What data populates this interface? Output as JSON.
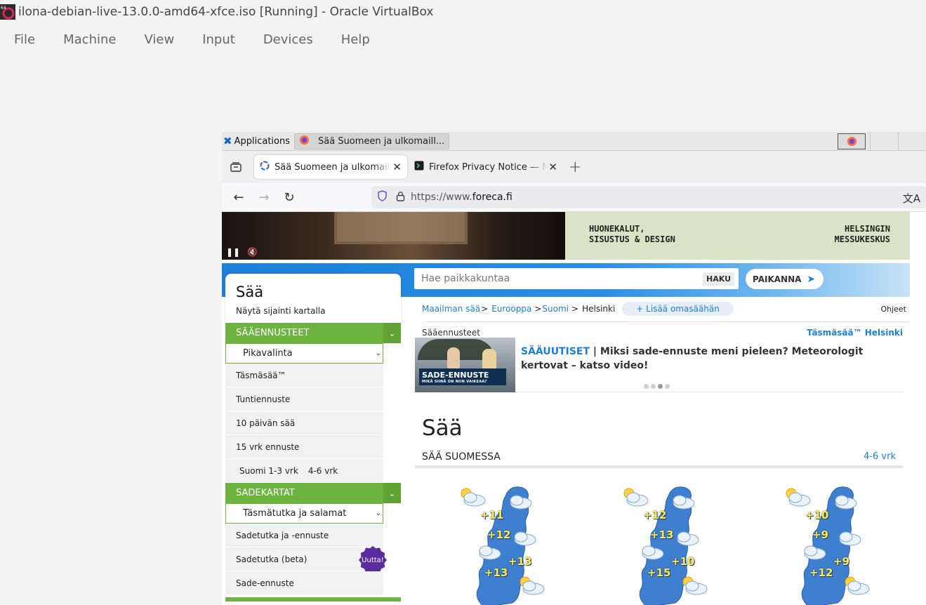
{
  "host": {
    "title": "ilona-debian-live-13.0.0-amd64-xfce.iso [Running] - Oracle VirtualBox",
    "menu": [
      "File",
      "Machine",
      "View",
      "Input",
      "Devices",
      "Help"
    ]
  },
  "xfce": {
    "applications_label": "Applications",
    "task_label": "Sää Suomeen ja ulkomaill..."
  },
  "browser": {
    "tabs": [
      {
        "label": "Sää Suomeen ja ulkomaille",
        "active": true
      },
      {
        "label": "Firefox Privacy Notice — M",
        "active": false
      }
    ],
    "url_prefix": "https://www.",
    "url_domain": "foreca.fi"
  },
  "ad": {
    "left_line1": "HUONEKALUT,",
    "left_line2": "SISUSTUS & DESIGN",
    "right_line1": "HELSINGIN",
    "right_line2": "MESSUKESKUS"
  },
  "search": {
    "placeholder": "Hae paikkakuntaa",
    "button": "HAKU",
    "locate": "PAIKANNA"
  },
  "sidebar": {
    "title": "Sää",
    "map_link": "Näytä sijainti kartalla",
    "section1": "SÄÄENNUSTEET",
    "select1": "Pikavalinta",
    "items1": [
      "Täsmäsää™",
      "Tuntiennuste",
      "10 päivän sää",
      "15 vrk ennuste"
    ],
    "suomi_label": "Suomi 1-3 vrk",
    "suomi_label2": "4-6 vrk",
    "section2": "SADEKARTAT",
    "select2": "Täsmätutka ja salamat",
    "items2": [
      "Sadetutka ja -ennuste",
      "Sadetutka (beta)",
      "Sade-ennuste"
    ],
    "badge": "Uutta!"
  },
  "breadcrumb": {
    "l1": "Maailman sää",
    "l2": "Eurooppa",
    "l3": "Suomi",
    "current": "Helsinki",
    "add_fav": "+ Lisää omasäähän",
    "help": "Ohjeet"
  },
  "forecast_head": {
    "left": "Sääennusteet",
    "right": "Täsmäsää™ Helsinki"
  },
  "news": {
    "tag": "SÄÄUUTISET",
    "sep": " | ",
    "headline": "Miksi sade-ennuste meni pieleen? Meteorologit kertovat – katso video!",
    "thumb_title": "SADE-ENNUSTE",
    "thumb_sub": "MIKÄ SIINÄ ON NIIN VAIKEAA?"
  },
  "main": {
    "heading": "Sää",
    "section": "SÄÄ SUOMESSA",
    "section_link": "4-6 vrk"
  },
  "maps": [
    {
      "temps": [
        "+11",
        "+12",
        "+13",
        "+13"
      ]
    },
    {
      "temps": [
        "+12",
        "+13",
        "+10",
        "+15"
      ]
    },
    {
      "temps": [
        "+10",
        "+9",
        "+9",
        "+12"
      ]
    }
  ],
  "colors": {
    "accent_blue": "#1c7fd8",
    "menu_green": "#6cb33f",
    "badge_purple": "#5b2ca0"
  }
}
